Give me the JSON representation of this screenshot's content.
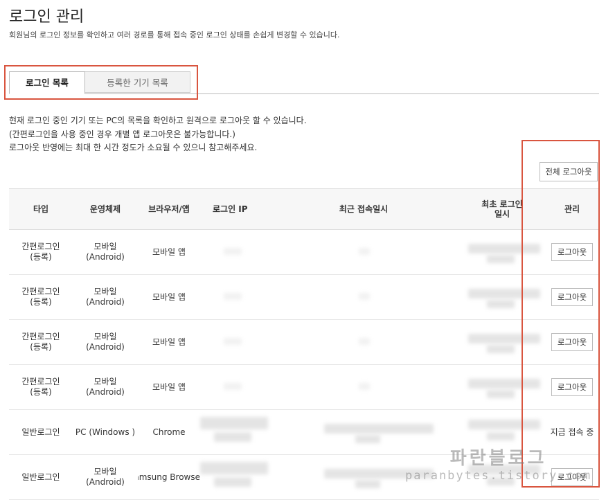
{
  "page": {
    "title": "로그인 관리",
    "description": "회원님의 로그인 정보를 확인하고 여러 경로를 통해 접속 중인 로그인 상태를 손쉽게 변경할 수 있습니다."
  },
  "tabs": [
    {
      "label": "로그인 목록",
      "active": true
    },
    {
      "label": "등록한 기기 목록",
      "active": false
    }
  ],
  "notice": [
    "현재 로그인 중인 기기 또는 PC의 목록을 확인하고 원격으로 로그아웃 할 수 있습니다.",
    "(간편로그인을 사용 중인 경우 개별 앱 로그아웃은 불가능합니다.)",
    "로그아웃 반영에는 최대 한 시간 정도가 소요될 수 있으니 참고해주세요."
  ],
  "logout_all_label": "전체 로그아웃",
  "table": {
    "headers": [
      "타입",
      "운영체제",
      "브라우저/앱",
      "로그인 IP",
      "최근 접속일시",
      "최초 로그인\n일시",
      "관리"
    ],
    "rows": [
      {
        "type": "간편로그인\n(등록)",
        "os": "모바일\n(Android)",
        "browser": "모바일 앱",
        "action": "로그아웃"
      },
      {
        "type": "간편로그인\n(등록)",
        "os": "모바일\n(Android)",
        "browser": "모바일 앱",
        "action": "로그아웃"
      },
      {
        "type": "간편로그인\n(등록)",
        "os": "모바일\n(Android)",
        "browser": "모바일 앱",
        "action": "로그아웃"
      },
      {
        "type": "간편로그인\n(등록)",
        "os": "모바일\n(Android)",
        "browser": "모바일 앱",
        "action": "로그아웃"
      },
      {
        "type": "일반로그인",
        "os": "PC (Windows )",
        "browser": "Chrome",
        "status": "지금 접속 중"
      },
      {
        "type": "일반로그인",
        "os": "모바일\n(Android)",
        "browser": "Samsung Browse",
        "action": "로그아웃"
      }
    ]
  },
  "watermark": {
    "line1": "파란블로그",
    "line2": "paranbytes.tistory.com"
  },
  "colors": {
    "highlight": "#d9553f",
    "header_bg": "#f7f7f7",
    "tab_inactive_bg": "#f2f2f2"
  }
}
